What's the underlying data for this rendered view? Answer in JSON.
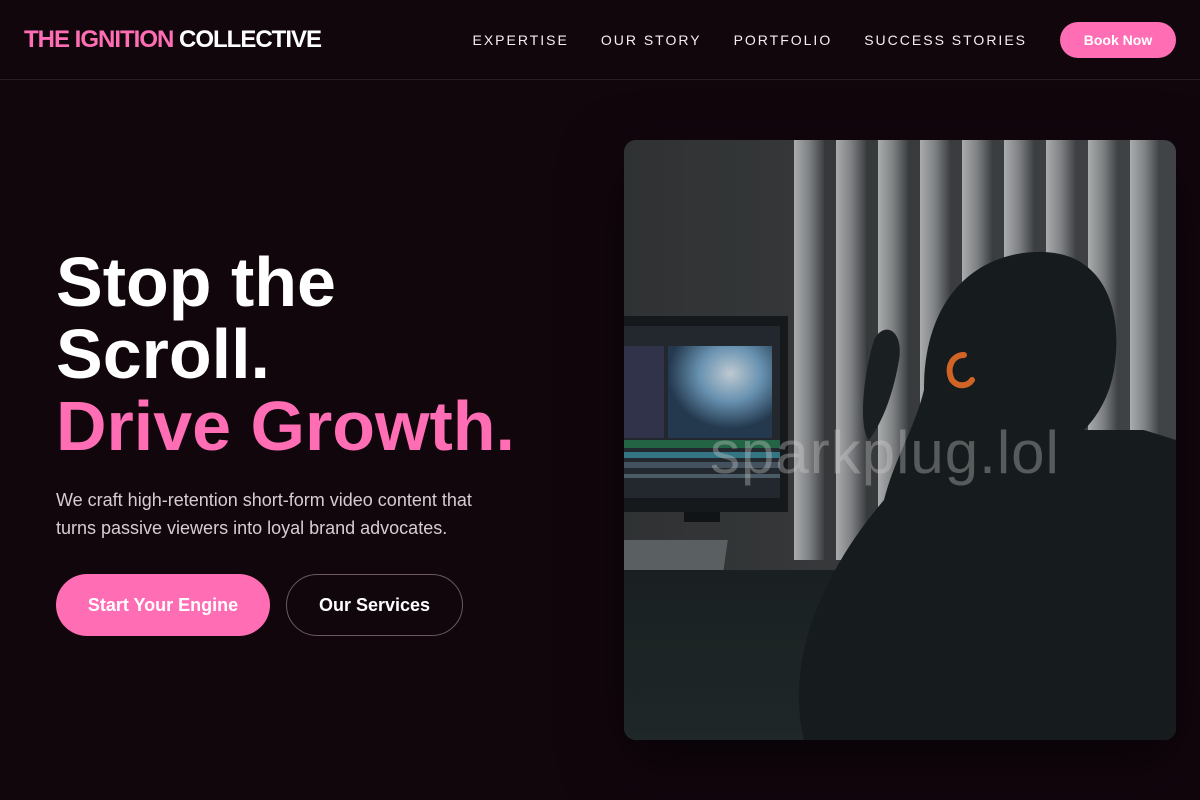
{
  "header": {
    "brand_accent": "THE IGNITION",
    "brand_main": "COLLECTIVE",
    "nav": [
      "EXPERTISE",
      "OUR STORY",
      "PORTFOLIO",
      "SUCCESS STORIES"
    ],
    "cta_label": "Book Now"
  },
  "hero": {
    "title_line1": "Stop the",
    "title_line2": "Scroll.",
    "title_accent": "Drive Growth.",
    "subtitle": "We craft high-retention short-form video content that turns passive viewers into loyal brand advocates.",
    "primary_cta": "Start Your Engine",
    "secondary_cta": "Our Services",
    "image_watermark": "sparkplug.lol"
  },
  "colors": {
    "background": "#12060d",
    "accent": "#ff6eb4",
    "text": "#ffffff",
    "muted_text": "#d6cdd3"
  }
}
